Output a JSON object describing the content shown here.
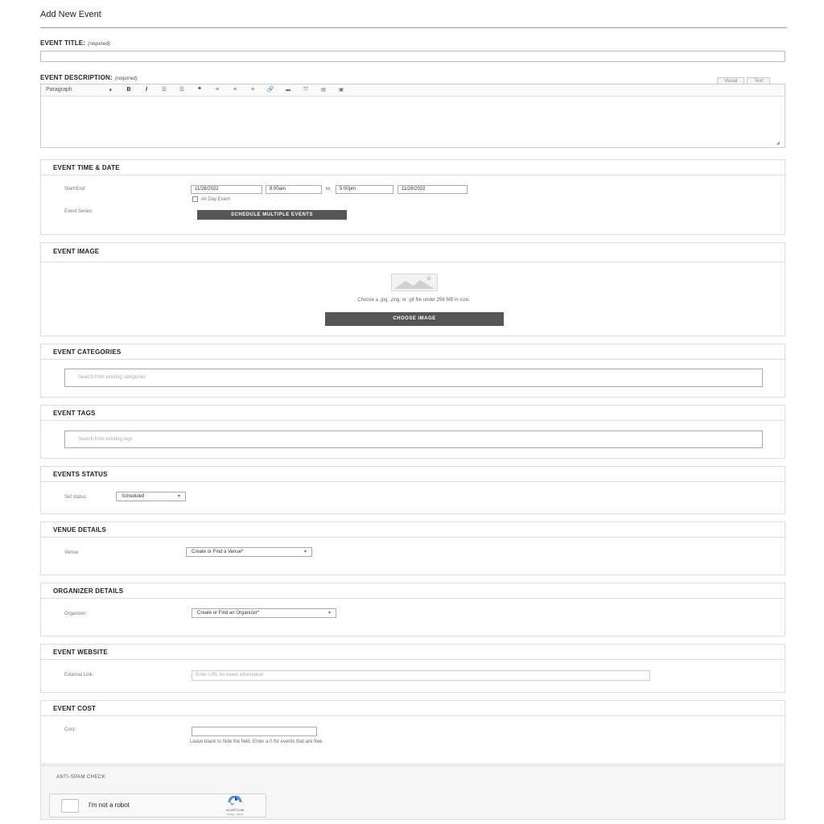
{
  "page": {
    "title": "Add New Event"
  },
  "event_title": {
    "label": "EVENT TITLE:",
    "required_note": "(required)",
    "value": ""
  },
  "event_description": {
    "label": "EVENT DESCRIPTION:",
    "required_note": "(required)",
    "tabs": [
      "Visual",
      "Text"
    ],
    "toolbar": {
      "format_select": "Paragraph",
      "buttons": [
        "bold",
        "italic",
        "bullet-list",
        "numbered-list",
        "blockquote",
        "align-left",
        "align-center",
        "align-right",
        "link",
        "read-more",
        "fullscreen",
        "toolbar-toggle",
        "kitchen-sink"
      ],
      "bold_glyph": "B",
      "italic_glyph": "I",
      "quote_glyph": "❝"
    }
  },
  "time_date": {
    "header": "EVENT TIME & DATE",
    "start_end_label": "Start/End:",
    "start_date": "11/28/2022",
    "start_time": "8:00am",
    "to_label": "to",
    "end_time": "5:00pm",
    "end_date": "11/28/2022",
    "all_day_label": "All Day Event",
    "series_label": "Event Series:",
    "schedule_button": "SCHEDULE MULTIPLE EVENTS"
  },
  "event_image": {
    "header": "EVENT IMAGE",
    "helper": "Choose a .jpg, .png, or .gif file under 256 MB in size.",
    "button": "CHOOSE IMAGE"
  },
  "categories": {
    "header": "EVENT CATEGORIES",
    "placeholder": "Search from existing categories"
  },
  "tags": {
    "header": "EVENT TAGS",
    "placeholder": "Search from existing tags"
  },
  "status": {
    "header": "EVENTS STATUS",
    "label": "Set status:",
    "value": "Scheduled"
  },
  "venue": {
    "header": "VENUE DETAILS",
    "label": "Venue:",
    "value": "Create or Find a Venue*"
  },
  "organizer": {
    "header": "ORGANIZER DETAILS",
    "label": "Organizer:",
    "value": "Create or Find an Organizer*"
  },
  "website": {
    "header": "EVENT WEBSITE",
    "label": "External Link:",
    "placeholder": "Enter URL for event information"
  },
  "cost": {
    "header": "EVENT COST",
    "label": "Cost:",
    "helper": "Leave blank to hide the field. Enter a 0 for events that are free."
  },
  "antispam": {
    "header": "ANTI-SPAM CHECK",
    "checkbox_label": "I'm not a robot",
    "brand": "reCAPTCHA",
    "links": "Privacy - Terms"
  },
  "colors": {
    "dark_button": "#555555",
    "border": "#dddddd",
    "recaptcha_blue": "#4a90e2"
  }
}
